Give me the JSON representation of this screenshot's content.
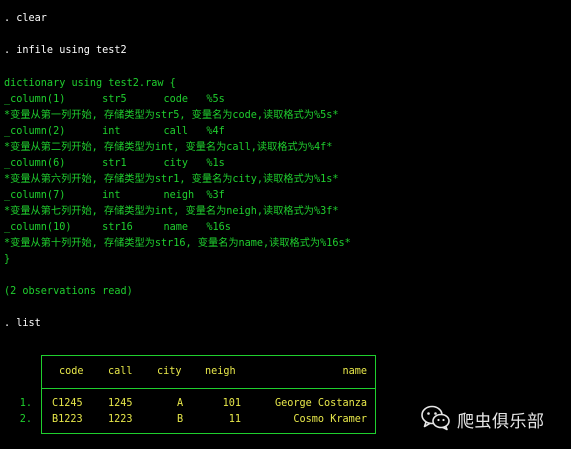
{
  "console": {
    "cmd_clear": ". clear",
    "cmd_infile": ". infile using test2",
    "dict_open": "dictionary using test2.raw {",
    "col1": "_column(1)      str5      code   %5s",
    "com1": "*变量从第一列开始, 存储类型为str5, 变量名为code,读取格式为%5s*",
    "col2": "_column(2)      int       call   %4f",
    "com2": "*变量从第二列开始, 存储类型为int, 变量名为call,读取格式为%4f*",
    "col6": "_column(6)      str1      city   %1s",
    "com6": "*变量从第六列开始, 存储类型为str1, 变量名为city,读取格式为%1s*",
    "col7": "_column(7)      int       neigh  %3f",
    "com7": "*变量从第七列开始, 存储类型为int, 变量名为neigh,读取格式为%3f*",
    "col10": "_column(10)     str16     name   %16s",
    "com10": "*变量从第十列开始, 存储类型为str16, 变量名为name,读取格式为%16s*",
    "dict_close": "}",
    "obs_read": "(2 observations read)",
    "cmd_list": ". list"
  },
  "list_table": {
    "headers": {
      "code": "code",
      "call": "call",
      "city": "city",
      "neigh": "neigh",
      "name": "name"
    },
    "rows": [
      {
        "num": "1.",
        "code": "C1245",
        "call": "1245",
        "city": "A",
        "neigh": "101",
        "name": "George Costanza"
      },
      {
        "num": "2.",
        "code": "B1223",
        "call": "1223",
        "city": "B",
        "neigh": "11",
        "name": "Cosmo Kramer"
      }
    ]
  },
  "watermark": {
    "text": "爬虫俱乐部",
    "icon": "wechat-icon"
  },
  "colors": {
    "background": "#000000",
    "command": "#ffffff",
    "output": "#1fcf2e",
    "result": "#e8e84a"
  }
}
